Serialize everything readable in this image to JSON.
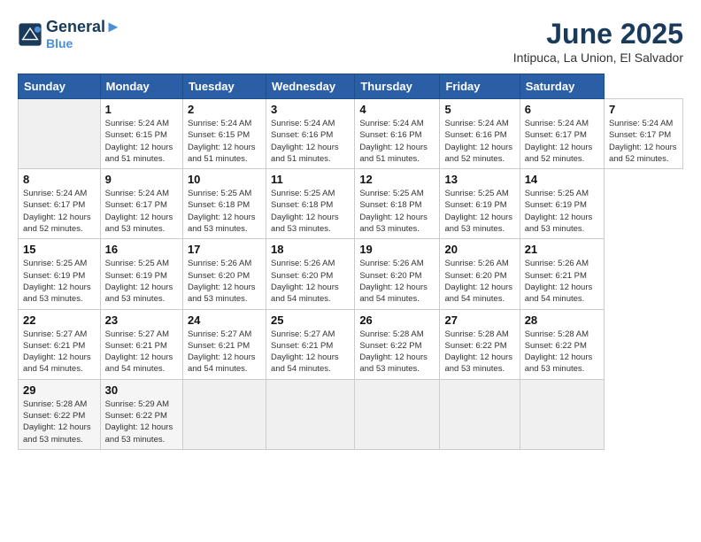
{
  "header": {
    "logo_line1": "General",
    "logo_line2": "Blue",
    "month_title": "June 2025",
    "location": "Intipuca, La Union, El Salvador"
  },
  "weekdays": [
    "Sunday",
    "Monday",
    "Tuesday",
    "Wednesday",
    "Thursday",
    "Friday",
    "Saturday"
  ],
  "days": [
    {
      "num": "",
      "sunrise": "",
      "sunset": "",
      "daylight": ""
    },
    {
      "num": "1",
      "sunrise": "Sunrise: 5:24 AM",
      "sunset": "Sunset: 6:15 PM",
      "daylight": "Daylight: 12 hours and 51 minutes."
    },
    {
      "num": "2",
      "sunrise": "Sunrise: 5:24 AM",
      "sunset": "Sunset: 6:15 PM",
      "daylight": "Daylight: 12 hours and 51 minutes."
    },
    {
      "num": "3",
      "sunrise": "Sunrise: 5:24 AM",
      "sunset": "Sunset: 6:16 PM",
      "daylight": "Daylight: 12 hours and 51 minutes."
    },
    {
      "num": "4",
      "sunrise": "Sunrise: 5:24 AM",
      "sunset": "Sunset: 6:16 PM",
      "daylight": "Daylight: 12 hours and 51 minutes."
    },
    {
      "num": "5",
      "sunrise": "Sunrise: 5:24 AM",
      "sunset": "Sunset: 6:16 PM",
      "daylight": "Daylight: 12 hours and 52 minutes."
    },
    {
      "num": "6",
      "sunrise": "Sunrise: 5:24 AM",
      "sunset": "Sunset: 6:17 PM",
      "daylight": "Daylight: 12 hours and 52 minutes."
    },
    {
      "num": "7",
      "sunrise": "Sunrise: 5:24 AM",
      "sunset": "Sunset: 6:17 PM",
      "daylight": "Daylight: 12 hours and 52 minutes."
    },
    {
      "num": "8",
      "sunrise": "Sunrise: 5:24 AM",
      "sunset": "Sunset: 6:17 PM",
      "daylight": "Daylight: 12 hours and 52 minutes."
    },
    {
      "num": "9",
      "sunrise": "Sunrise: 5:24 AM",
      "sunset": "Sunset: 6:17 PM",
      "daylight": "Daylight: 12 hours and 53 minutes."
    },
    {
      "num": "10",
      "sunrise": "Sunrise: 5:25 AM",
      "sunset": "Sunset: 6:18 PM",
      "daylight": "Daylight: 12 hours and 53 minutes."
    },
    {
      "num": "11",
      "sunrise": "Sunrise: 5:25 AM",
      "sunset": "Sunset: 6:18 PM",
      "daylight": "Daylight: 12 hours and 53 minutes."
    },
    {
      "num": "12",
      "sunrise": "Sunrise: 5:25 AM",
      "sunset": "Sunset: 6:18 PM",
      "daylight": "Daylight: 12 hours and 53 minutes."
    },
    {
      "num": "13",
      "sunrise": "Sunrise: 5:25 AM",
      "sunset": "Sunset: 6:19 PM",
      "daylight": "Daylight: 12 hours and 53 minutes."
    },
    {
      "num": "14",
      "sunrise": "Sunrise: 5:25 AM",
      "sunset": "Sunset: 6:19 PM",
      "daylight": "Daylight: 12 hours and 53 minutes."
    },
    {
      "num": "15",
      "sunrise": "Sunrise: 5:25 AM",
      "sunset": "Sunset: 6:19 PM",
      "daylight": "Daylight: 12 hours and 53 minutes."
    },
    {
      "num": "16",
      "sunrise": "Sunrise: 5:25 AM",
      "sunset": "Sunset: 6:19 PM",
      "daylight": "Daylight: 12 hours and 53 minutes."
    },
    {
      "num": "17",
      "sunrise": "Sunrise: 5:26 AM",
      "sunset": "Sunset: 6:20 PM",
      "daylight": "Daylight: 12 hours and 53 minutes."
    },
    {
      "num": "18",
      "sunrise": "Sunrise: 5:26 AM",
      "sunset": "Sunset: 6:20 PM",
      "daylight": "Daylight: 12 hours and 54 minutes."
    },
    {
      "num": "19",
      "sunrise": "Sunrise: 5:26 AM",
      "sunset": "Sunset: 6:20 PM",
      "daylight": "Daylight: 12 hours and 54 minutes."
    },
    {
      "num": "20",
      "sunrise": "Sunrise: 5:26 AM",
      "sunset": "Sunset: 6:20 PM",
      "daylight": "Daylight: 12 hours and 54 minutes."
    },
    {
      "num": "21",
      "sunrise": "Sunrise: 5:26 AM",
      "sunset": "Sunset: 6:21 PM",
      "daylight": "Daylight: 12 hours and 54 minutes."
    },
    {
      "num": "22",
      "sunrise": "Sunrise: 5:27 AM",
      "sunset": "Sunset: 6:21 PM",
      "daylight": "Daylight: 12 hours and 54 minutes."
    },
    {
      "num": "23",
      "sunrise": "Sunrise: 5:27 AM",
      "sunset": "Sunset: 6:21 PM",
      "daylight": "Daylight: 12 hours and 54 minutes."
    },
    {
      "num": "24",
      "sunrise": "Sunrise: 5:27 AM",
      "sunset": "Sunset: 6:21 PM",
      "daylight": "Daylight: 12 hours and 54 minutes."
    },
    {
      "num": "25",
      "sunrise": "Sunrise: 5:27 AM",
      "sunset": "Sunset: 6:21 PM",
      "daylight": "Daylight: 12 hours and 54 minutes."
    },
    {
      "num": "26",
      "sunrise": "Sunrise: 5:28 AM",
      "sunset": "Sunset: 6:22 PM",
      "daylight": "Daylight: 12 hours and 53 minutes."
    },
    {
      "num": "27",
      "sunrise": "Sunrise: 5:28 AM",
      "sunset": "Sunset: 6:22 PM",
      "daylight": "Daylight: 12 hours and 53 minutes."
    },
    {
      "num": "28",
      "sunrise": "Sunrise: 5:28 AM",
      "sunset": "Sunset: 6:22 PM",
      "daylight": "Daylight: 12 hours and 53 minutes."
    },
    {
      "num": "29",
      "sunrise": "Sunrise: 5:28 AM",
      "sunset": "Sunset: 6:22 PM",
      "daylight": "Daylight: 12 hours and 53 minutes."
    },
    {
      "num": "30",
      "sunrise": "Sunrise: 5:29 AM",
      "sunset": "Sunset: 6:22 PM",
      "daylight": "Daylight: 12 hours and 53 minutes."
    }
  ]
}
